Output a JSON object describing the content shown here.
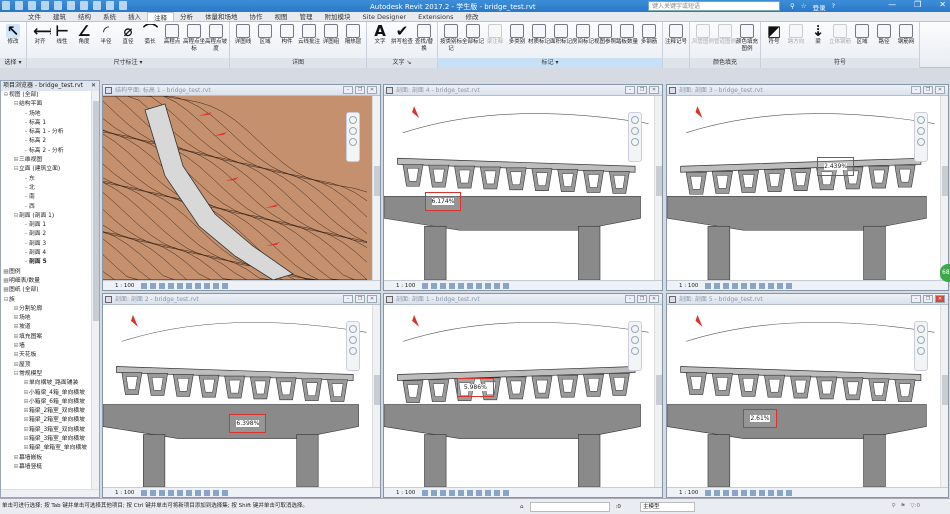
{
  "app": {
    "title": "Autodesk Revit 2017.2 - 学生版 -   bridge_test.rvt",
    "search_placeholder": "键入关键字或短语",
    "user": "登录",
    "help": "?"
  },
  "tabs": [
    "文件",
    "建筑",
    "结构",
    "系统",
    "插入",
    "注释",
    "分析",
    "体量和场地",
    "协作",
    "视图",
    "管理",
    "附加模块",
    "Site Designer",
    "Extensions",
    "修改"
  ],
  "active_tab": "注释",
  "ribbon": [
    {
      "label": "选择 ▾",
      "tools": [
        "修改"
      ]
    },
    {
      "label": "尺寸标注 ▾",
      "tools": [
        "对齐",
        "线性",
        "角度",
        "半径",
        "直径",
        "弧长",
        "高程点",
        "高程点坐标",
        "高程点坡度"
      ]
    },
    {
      "label": "详图",
      "tools": [
        "详图线",
        "区域",
        "构件",
        "云线批注",
        "详图组",
        "隔热层"
      ]
    },
    {
      "label": "文字 ↘",
      "tools": [
        "文字",
        "拼写检查",
        "查找/替换"
      ]
    },
    {
      "label": "标记 ▾",
      "tools": [
        "按类别标记",
        "全部标记",
        "梁注释",
        "多类别",
        "材质标记",
        "面积标记",
        "房间标记",
        "视图参照",
        "踏板数量",
        "多钢筋"
      ]
    },
    {
      "label": "",
      "tools": [
        "注释记号"
      ]
    },
    {
      "label": "颜色填充",
      "tools": [
        "风管图例",
        "管道图例",
        "颜色填充图例"
      ]
    },
    {
      "label": "符号",
      "tools": [
        "符号",
        "跨方向",
        "梁",
        "立体钢筋",
        "区域",
        "路径",
        "钢筋网"
      ]
    }
  ],
  "browser": {
    "title": "项目浏览器 - bridge_test.rvt",
    "items": [
      {
        "t": "视图 (全部)",
        "l": 0,
        "tg": "⊖"
      },
      {
        "t": "结构平面",
        "l": 1,
        "tg": "⊟"
      },
      {
        "t": "场地",
        "l": 2
      },
      {
        "t": "标高 1",
        "l": 2
      },
      {
        "t": "标高 1 - 分析",
        "l": 2
      },
      {
        "t": "标高 2",
        "l": 2
      },
      {
        "t": "标高 2 - 分析",
        "l": 2
      },
      {
        "t": "三维视图",
        "l": 1,
        "tg": "⊞"
      },
      {
        "t": "立面 (建筑立面)",
        "l": 1,
        "tg": "⊟"
      },
      {
        "t": "东",
        "l": 2
      },
      {
        "t": "北",
        "l": 2
      },
      {
        "t": "南",
        "l": 2
      },
      {
        "t": "西",
        "l": 2
      },
      {
        "t": "剖面 (剖面 1)",
        "l": 1,
        "tg": "⊟"
      },
      {
        "t": "剖面 1",
        "l": 2
      },
      {
        "t": "剖面 2",
        "l": 2
      },
      {
        "t": "剖面 3",
        "l": 2
      },
      {
        "t": "剖面 4",
        "l": 2
      },
      {
        "t": "剖面 5",
        "l": 2,
        "cur": true
      },
      {
        "t": "图例",
        "l": 0,
        "tg": "▦"
      },
      {
        "t": "明细表/数量",
        "l": 0,
        "tg": "▦"
      },
      {
        "t": "图纸 (全部)",
        "l": 0,
        "tg": "▦"
      },
      {
        "t": "族",
        "l": 0,
        "tg": "⊟"
      },
      {
        "t": "分割轮廓",
        "l": 1,
        "tg": "⊞"
      },
      {
        "t": "场地",
        "l": 1,
        "tg": "⊞"
      },
      {
        "t": "坡道",
        "l": 1,
        "tg": "⊞"
      },
      {
        "t": "填充图案",
        "l": 1,
        "tg": "⊞"
      },
      {
        "t": "墙",
        "l": 1,
        "tg": "⊞"
      },
      {
        "t": "天花板",
        "l": 1,
        "tg": "⊞"
      },
      {
        "t": "屋顶",
        "l": 1,
        "tg": "⊞"
      },
      {
        "t": "常规模型",
        "l": 1,
        "tg": "⊟"
      },
      {
        "t": "单向横坡_路面铺装",
        "l": 2,
        "tg": "⊞"
      },
      {
        "t": "小箱梁_4箱_单向横坡",
        "l": 2,
        "tg": "⊞"
      },
      {
        "t": "小箱梁_6箱_单向横坡",
        "l": 2,
        "tg": "⊞"
      },
      {
        "t": "箱梁_2箱室_双向横坡",
        "l": 2,
        "tg": "⊞"
      },
      {
        "t": "箱梁_2箱室_单向横坡",
        "l": 2,
        "tg": "⊞"
      },
      {
        "t": "箱梁_3箱室_双向横坡",
        "l": 2,
        "tg": "⊞"
      },
      {
        "t": "箱梁_3箱室_单向横坡",
        "l": 2,
        "tg": "⊞"
      },
      {
        "t": "箱梁_单箱室_单向横坡",
        "l": 2,
        "tg": "⊞"
      },
      {
        "t": "幕墙嵌板",
        "l": 1,
        "tg": "⊞"
      },
      {
        "t": "幕墙竖梃",
        "l": 1,
        "tg": "⊞"
      }
    ]
  },
  "views": [
    {
      "title": "结构平面: 标高 1 - bridge_test.rvt",
      "scale": "1 : 100",
      "kind": "plan"
    },
    {
      "title": "剖面: 剖面 4 - bridge_test.rvt",
      "scale": "1 : 100",
      "kind": "section",
      "slope": "6.174%"
    },
    {
      "title": "剖面: 剖面 3 - bridge_test.rvt",
      "scale": "1 : 100",
      "kind": "section",
      "slope": "2.439%"
    },
    {
      "title": "剖面: 剖面 2 - bridge_test.rvt",
      "scale": "1 : 100",
      "kind": "section",
      "slope": "6.398%"
    },
    {
      "title": "剖面: 剖面 1 - bridge_test.rvt",
      "scale": "1 : 100",
      "kind": "section",
      "slope": "5.986%"
    },
    {
      "title": "剖面: 剖面 5 - bridge_test.rvt",
      "scale": "1 : 100",
      "kind": "section",
      "slope": "2.61%",
      "active": true
    }
  ],
  "status": {
    "hint": "单击可进行选择; 按 Tab 键并单击可选择其他项目; 按 Ctrl 键并单击可将新项目添加到选择集; 按 Shift 键并单击可取消选择。",
    "zero": ":0",
    "model": "主模型",
    "filter": "▽:0"
  },
  "colors": {
    "accent": "#2a78c8",
    "annotation": "#d9332b",
    "terrain": "#c4906d",
    "concrete": "#8a8a8a"
  }
}
